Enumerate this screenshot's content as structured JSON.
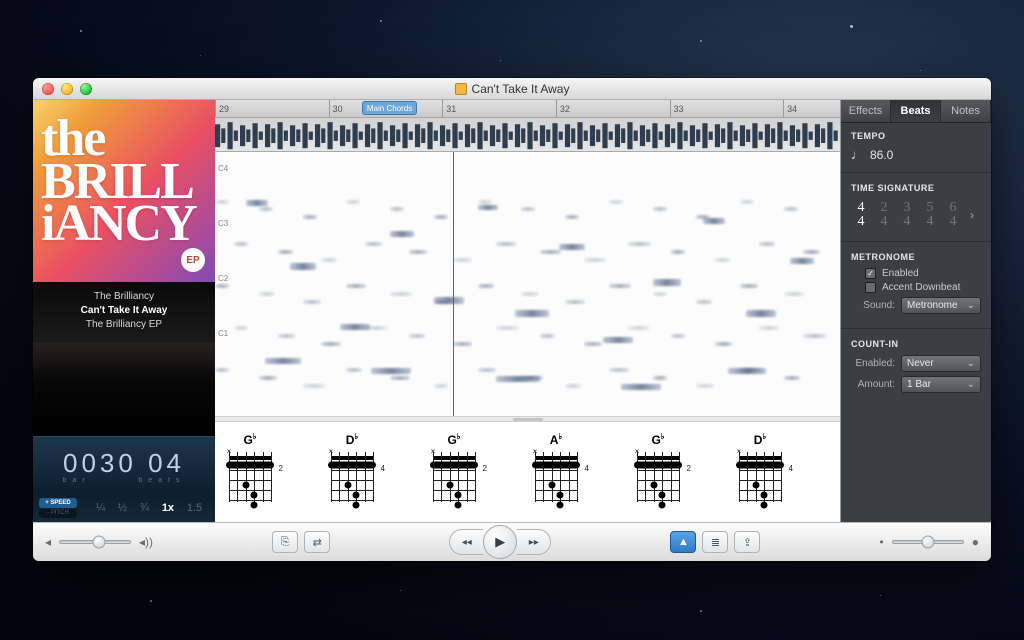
{
  "window_title": "Can't Take It Away",
  "track_info": {
    "artist": "The Brilliancy",
    "title": "Can't Take It Away",
    "album": "The Brilliancy EP",
    "cover_line1": "the",
    "cover_line2": "BRILL",
    "cover_line3": "iANCY",
    "cover_badge": "EP"
  },
  "position": {
    "bar": "0030",
    "beat": "04",
    "bar_label": "bar",
    "beat_label": "beats"
  },
  "speed": {
    "toggle_on": "+ SPEED",
    "toggle_off": "- PITCH",
    "options": [
      "¼",
      "½",
      "¾",
      "1x",
      "1.5"
    ],
    "selected_index": 3
  },
  "timeline": {
    "ticks": [
      29,
      30,
      31,
      32,
      33,
      34
    ],
    "marker_label": "Main Chords",
    "marker_left_pct": 23.5,
    "playhead_pct": 38,
    "y_labels": [
      "C4",
      "C3",
      "C2",
      "C1"
    ]
  },
  "chords": [
    {
      "name": "G♭",
      "pos": "2",
      "mutes": [
        0
      ],
      "bar_from": 0,
      "bar_to": 5,
      "dots": [
        [
          2,
          2
        ],
        [
          3,
          3
        ],
        [
          4,
          3
        ]
      ]
    },
    {
      "name": "D♭",
      "pos": "4",
      "mutes": [
        0
      ],
      "bar_from": 0,
      "bar_to": 5,
      "dots": [
        [
          2,
          2
        ],
        [
          3,
          3
        ],
        [
          4,
          3
        ]
      ]
    },
    {
      "name": "G♭",
      "pos": "2",
      "mutes": [
        0
      ],
      "bar_from": 0,
      "bar_to": 5,
      "dots": [
        [
          2,
          2
        ],
        [
          3,
          3
        ],
        [
          4,
          3
        ]
      ]
    },
    {
      "name": "A♭",
      "pos": "4",
      "mutes": [
        0
      ],
      "bar_from": 0,
      "bar_to": 5,
      "dots": [
        [
          2,
          2
        ],
        [
          3,
          3
        ],
        [
          4,
          3
        ]
      ]
    },
    {
      "name": "G♭",
      "pos": "2",
      "mutes": [
        0
      ],
      "bar_from": 0,
      "bar_to": 5,
      "dots": [
        [
          2,
          2
        ],
        [
          3,
          3
        ],
        [
          4,
          3
        ]
      ]
    },
    {
      "name": "D♭",
      "pos": "4",
      "mutes": [
        0
      ],
      "bar_from": 0,
      "bar_to": 5,
      "dots": [
        [
          2,
          2
        ],
        [
          3,
          3
        ],
        [
          4,
          3
        ]
      ]
    }
  ],
  "panel": {
    "tabs": [
      "Effects",
      "Beats",
      "Notes"
    ],
    "active_tab": 1,
    "tempo_header": "TEMPO",
    "tempo_value": "86.0",
    "ts_header": "TIME SIGNATURE",
    "time_signatures": [
      [
        4,
        4
      ],
      [
        2,
        4
      ],
      [
        3,
        4
      ],
      [
        5,
        4
      ],
      [
        6,
        4
      ]
    ],
    "ts_selected": 0,
    "metronome_header": "METRONOME",
    "metronome_enabled_label": "Enabled",
    "metronome_accent_label": "Accent Downbeat",
    "metronome_enabled": true,
    "metronome_accent": false,
    "sound_label": "Sound:",
    "sound_value": "Metronome",
    "countin_header": "COUNT-IN",
    "countin_enabled_label": "Enabled:",
    "countin_enabled_value": "Never",
    "countin_amount_label": "Amount:",
    "countin_amount_value": "1 Bar"
  },
  "footer": {
    "volume_pct": 55,
    "pan_pct": 50
  }
}
